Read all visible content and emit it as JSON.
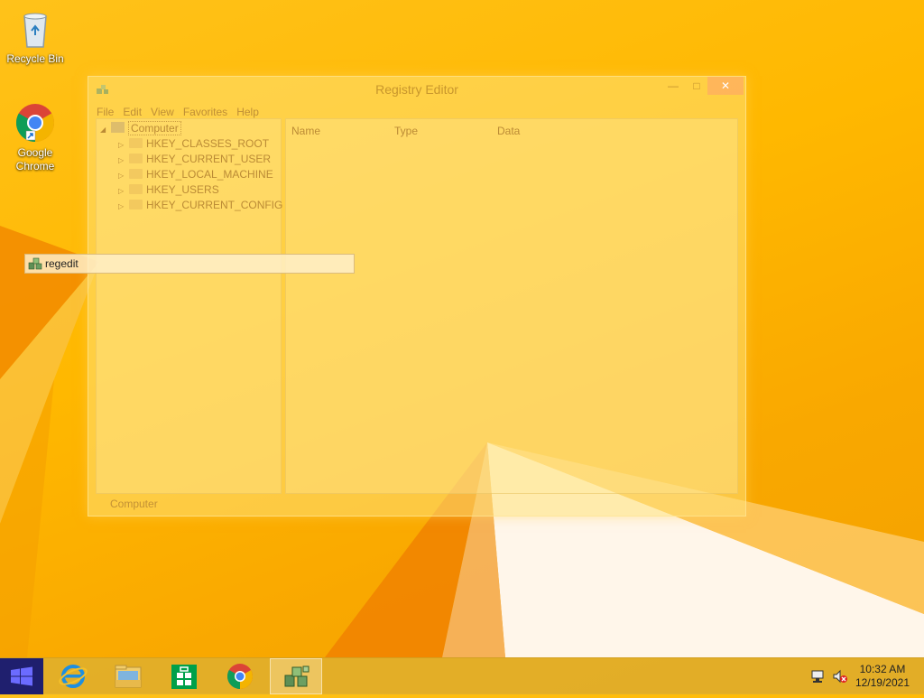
{
  "desktop": {
    "icons": [
      {
        "label": "Recycle Bin",
        "icon": "recycle-bin-icon"
      },
      {
        "label": "Google\nChrome",
        "line1": "Google",
        "line2": "Chrome",
        "icon": "chrome-icon"
      }
    ]
  },
  "registry_window": {
    "title": "Registry Editor",
    "controls": {
      "minimize": "—",
      "maximize": "□",
      "close": "✕"
    },
    "menu": [
      "File",
      "Edit",
      "View",
      "Favorites",
      "Help"
    ],
    "tree": {
      "root": "Computer",
      "root_expander": "◢",
      "expander": "▷",
      "keys": [
        "HKEY_CLASSES_ROOT",
        "HKEY_CURRENT_USER",
        "HKEY_LOCAL_MACHINE",
        "HKEY_USERS",
        "HKEY_CURRENT_CONFIG"
      ]
    },
    "columns": [
      "Name",
      "Type",
      "Data"
    ],
    "status": "Computer"
  },
  "run_box": {
    "value": "regedit",
    "icon": "regedit-icon"
  },
  "taskbar": {
    "start_icon": "windows-logo-icon",
    "pinned": [
      "internet-explorer-icon",
      "file-explorer-icon",
      "store-icon",
      "chrome-icon",
      "regedit-icon"
    ],
    "active_item": "regedit-icon",
    "tray": [
      "network-icon",
      "speaker-muted-icon"
    ],
    "time": "10:32 AM",
    "date": "12/19/2021"
  },
  "colors": {
    "wallpaper": "#ffb800",
    "start_button": "#1f1f6e",
    "accent_orange": "#f07a00"
  }
}
